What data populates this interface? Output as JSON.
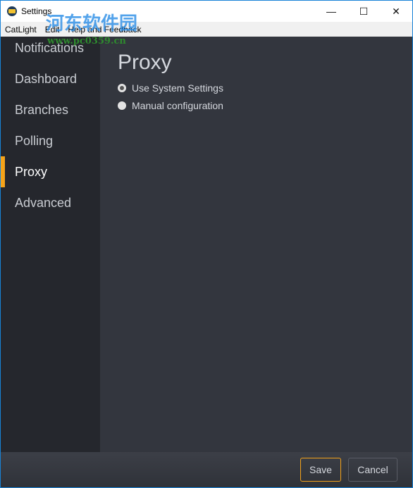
{
  "window": {
    "title": "Settings",
    "minimize": "—",
    "maximize": "☐",
    "close": "✕"
  },
  "menu": [
    "CatLight",
    "Edit",
    "Help and Feedback"
  ],
  "sidebar": {
    "items": [
      {
        "label": "Notifications"
      },
      {
        "label": "Dashboard"
      },
      {
        "label": "Branches"
      },
      {
        "label": "Polling"
      },
      {
        "label": "Proxy",
        "selected": true
      },
      {
        "label": "Advanced"
      }
    ]
  },
  "main": {
    "title": "Proxy",
    "options": [
      {
        "label": "Use System Settings",
        "checked": true
      },
      {
        "label": "Manual configuration",
        "checked": false
      }
    ]
  },
  "footer": {
    "save": "Save",
    "cancel": "Cancel"
  },
  "watermark": {
    "line1": "河东软件园",
    "line2": "www.pc0359.cn"
  },
  "colors": {
    "accent": "#f5a31a",
    "sidebar": "#25272d",
    "content": "#33363e"
  }
}
